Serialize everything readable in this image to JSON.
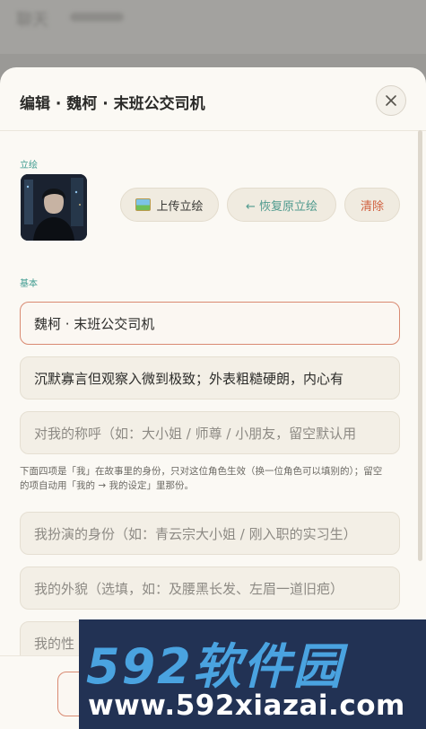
{
  "background": {
    "title": "聊天"
  },
  "modal": {
    "title": "编辑 · 魏柯 · 末班公交司机",
    "portrait_section_label": "立绘",
    "upload_label": "上传立绘",
    "restore_label": "← 恢复原立绘",
    "clear_label": "清除",
    "basic_section_label": "基本",
    "fields": {
      "name": "魏柯 · 末班公交司机",
      "description": "沉默寡言但观察入微到极致；外表粗糙硬朗，内心有",
      "address_placeholder": "对我的称呼（如：大小姐 / 师尊 / 小朋友，留空默认用",
      "hint": "下面四项是「我」在故事里的身份，只对这位角色生效（换一位角色可以填别的）；留空的项自动用「我的 → 我的设定」里那份。",
      "identity_placeholder": "我扮演的身份（如：青云宗大小姐 / 刚入职的实习生）",
      "appearance_placeholder": "我的外貌（选填，如：及腰黑长发、左眉一道旧疤）",
      "personality_placeholder": "我的性"
    }
  },
  "watermark": {
    "logo_text": "592软件园",
    "url": "www.592xiazai.com"
  }
}
